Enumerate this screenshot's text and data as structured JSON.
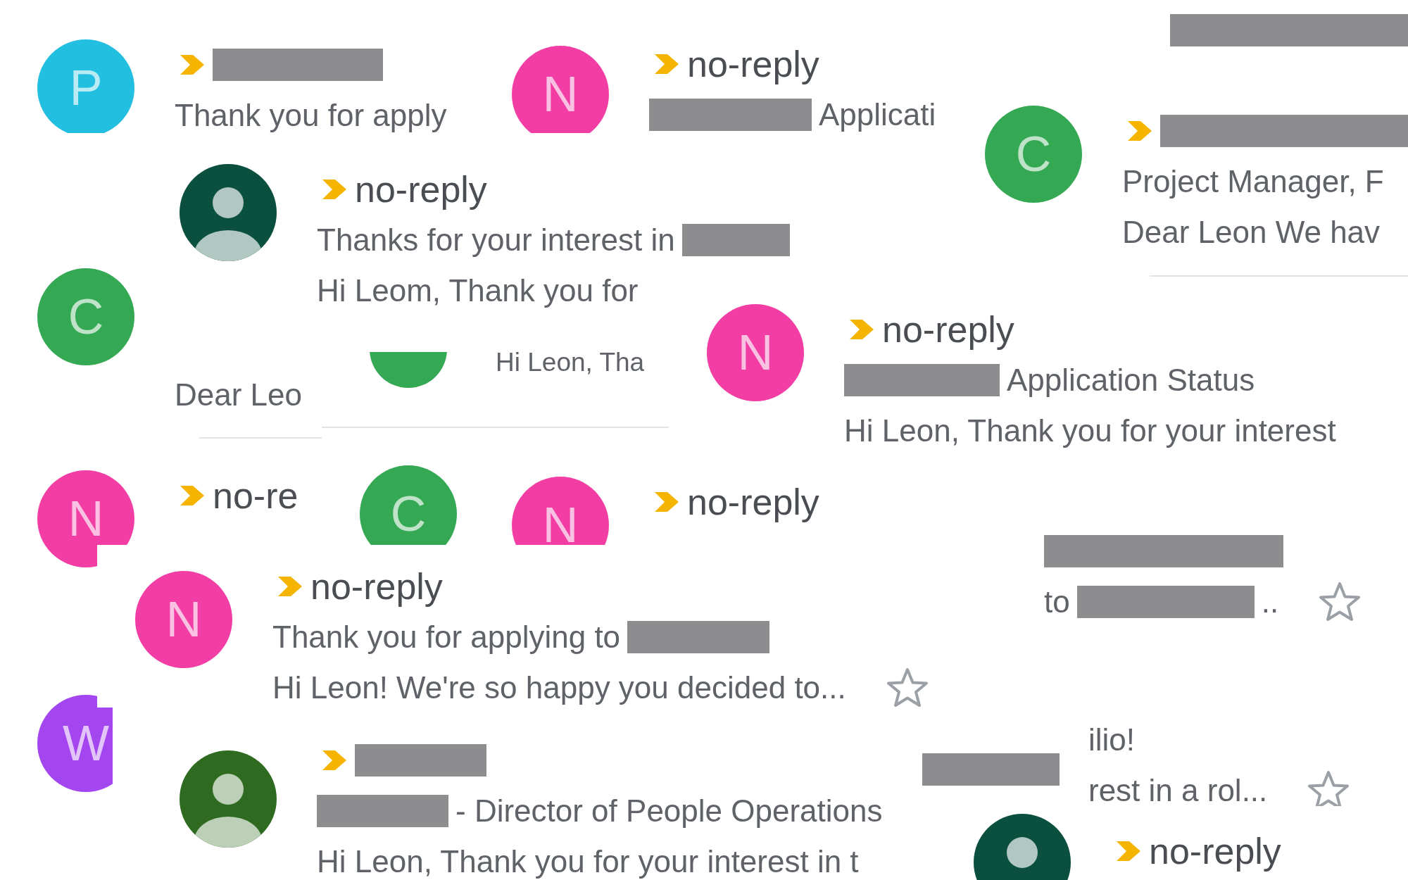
{
  "fragments": [
    {
      "avatar": {
        "kind": "letter",
        "text": "P",
        "color": "#23bfe0"
      },
      "lines": [
        {
          "kind": "sender",
          "important": true,
          "segments": [
            {
              "kind": "redacted"
            }
          ]
        },
        {
          "kind": "subject",
          "segments": [
            {
              "kind": "text",
              "text": "Thank you for apply"
            }
          ]
        }
      ]
    },
    {
      "avatar": {
        "kind": "letter",
        "text": "N",
        "color": "#f23ea4"
      },
      "lines": [
        {
          "kind": "sender",
          "important": true,
          "segments": [
            {
              "kind": "text",
              "text": "no-reply"
            }
          ]
        },
        {
          "kind": "subject",
          "segments": [
            {
              "kind": "redacted"
            },
            {
              "kind": "text",
              "text": "Applicati"
            }
          ]
        }
      ]
    },
    {
      "lines": [
        {
          "kind": "subject",
          "segments": [
            {
              "kind": "redacted"
            }
          ]
        }
      ]
    },
    {
      "avatar": {
        "kind": "letter",
        "text": "C",
        "color": "#34a853"
      },
      "lines": [
        {
          "kind": "sender",
          "important": true,
          "segments": [
            {
              "kind": "redacted"
            }
          ]
        },
        {
          "kind": "subject",
          "segments": [
            {
              "kind": "text",
              "text": "Project Manager, F"
            }
          ]
        },
        {
          "kind": "snippet",
          "segments": [
            {
              "kind": "text",
              "text": "Dear Leon We hav"
            }
          ]
        }
      ],
      "divider": true
    },
    {
      "avatar": {
        "kind": "person",
        "color": "#0b4f3f"
      },
      "lines": [
        {
          "kind": "sender",
          "important": true,
          "segments": [
            {
              "kind": "text",
              "text": "no-reply"
            }
          ]
        },
        {
          "kind": "subject",
          "segments": [
            {
              "kind": "text",
              "text": "Thanks for your interest in"
            },
            {
              "kind": "redacted"
            }
          ]
        },
        {
          "kind": "snippet",
          "segments": [
            {
              "kind": "text",
              "text": "Hi Leom, Thank you for"
            }
          ]
        }
      ]
    },
    {
      "avatar": {
        "kind": "letter",
        "text": "C",
        "color": "#34a853"
      },
      "lines": [
        {
          "kind": "snippet",
          "segments": [
            {
              "kind": "text",
              "text": "Dear Leo"
            }
          ]
        }
      ],
      "divider": true
    },
    {
      "avatar": {
        "kind": "partial",
        "color": "#34a853"
      },
      "lines": [
        {
          "kind": "snippet",
          "segments": [
            {
              "kind": "text",
              "text": "Hi Leon, Tha"
            }
          ]
        }
      ],
      "divider": true
    },
    {
      "avatar": {
        "kind": "letter",
        "text": "N",
        "color": "#f23ea4"
      },
      "lines": [
        {
          "kind": "sender",
          "important": true,
          "segments": [
            {
              "kind": "text",
              "text": "no-reply"
            }
          ]
        },
        {
          "kind": "subject",
          "segments": [
            {
              "kind": "redacted"
            },
            {
              "kind": "text",
              "text": "Application Status"
            }
          ]
        },
        {
          "kind": "snippet",
          "segments": [
            {
              "kind": "text",
              "text": "Hi Leon, Thank you for your interest"
            }
          ]
        }
      ]
    },
    {
      "avatar": {
        "kind": "letter",
        "text": "N",
        "color": "#f23ea4"
      },
      "lines": [
        {
          "kind": "sender",
          "important": true,
          "segments": [
            {
              "kind": "text",
              "text": "no-re"
            }
          ]
        }
      ]
    },
    {
      "avatar": {
        "kind": "letter",
        "text": "C",
        "color": "#34a853"
      }
    },
    {
      "avatar": {
        "kind": "letter",
        "text": "N",
        "color": "#f23ea4"
      },
      "lines": [
        {
          "kind": "sender",
          "important": true,
          "segments": [
            {
              "kind": "text",
              "text": "no-reply"
            }
          ]
        }
      ]
    },
    {
      "lines": [
        {
          "kind": "subject",
          "segments": [
            {
              "kind": "redacted"
            }
          ]
        },
        {
          "kind": "snippet",
          "starred": false,
          "segments": [
            {
              "kind": "text",
              "text": "to"
            },
            {
              "kind": "redacted"
            },
            {
              "kind": "text",
              "text": ".."
            }
          ]
        }
      ]
    },
    {
      "avatar": {
        "kind": "letter",
        "text": "N",
        "color": "#f23ea4"
      },
      "lines": [
        {
          "kind": "sender",
          "important": true,
          "segments": [
            {
              "kind": "text",
              "text": "no-reply"
            }
          ]
        },
        {
          "kind": "subject",
          "segments": [
            {
              "kind": "text",
              "text": "Thank you for applying to"
            },
            {
              "kind": "redacted"
            }
          ]
        },
        {
          "kind": "snippet",
          "starred": false,
          "segments": [
            {
              "kind": "text",
              "text": "Hi Leon! We're so happy you decided to..."
            }
          ]
        }
      ]
    },
    {
      "avatar": {
        "kind": "letter",
        "text": "W",
        "color": "#a446f0"
      }
    },
    {
      "avatar": {
        "kind": "person",
        "color": "#2e6b20"
      },
      "lines": [
        {
          "kind": "sender",
          "important": true,
          "segments": [
            {
              "kind": "redacted"
            }
          ]
        },
        {
          "kind": "subject",
          "segments": [
            {
              "kind": "redacted"
            },
            {
              "kind": "text",
              "text": "- Director of People Operations"
            }
          ]
        },
        {
          "kind": "snippet",
          "segments": [
            {
              "kind": "text",
              "text": "Hi Leon, Thank you for your interest in t"
            }
          ]
        }
      ]
    },
    {
      "lines": [
        {
          "kind": "subject",
          "segments": [
            {
              "kind": "redacted"
            }
          ]
        }
      ]
    },
    {
      "lines": [
        {
          "kind": "subject",
          "segments": [
            {
              "kind": "text",
              "text": "ilio!"
            }
          ]
        },
        {
          "kind": "snippet",
          "starred": false,
          "segments": [
            {
              "kind": "text",
              "text": "rest in a rol..."
            }
          ]
        }
      ]
    },
    {
      "avatar": {
        "kind": "person",
        "color": "#0b4f3f"
      },
      "lines": [
        {
          "kind": "sender",
          "important": true,
          "segments": [
            {
              "kind": "text",
              "text": "no-reply"
            }
          ]
        }
      ]
    }
  ]
}
